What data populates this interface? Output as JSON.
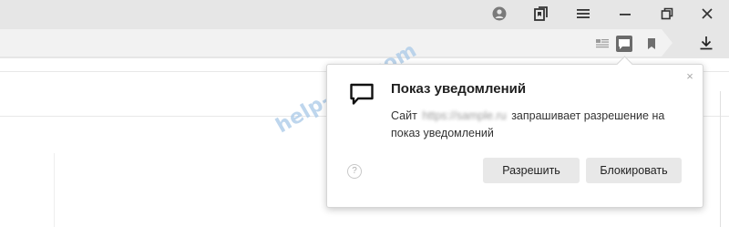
{
  "titlebar": {
    "icons": [
      "profile-icon",
      "bookmarks-manager-icon",
      "menu-icon",
      "minimize-icon",
      "restore-icon",
      "close-icon"
    ]
  },
  "addressbar": {
    "icons": [
      "reader-mode-icon",
      "notification-icon",
      "bookmark-icon",
      "download-icon"
    ]
  },
  "watermark": {
    "text": "help-wifi.com"
  },
  "popup": {
    "title": "Показ уведомлений",
    "body_prefix": "Сайт",
    "domain_blurred": "https://sample.ru",
    "body_suffix": "запрашивает разрешение на показ уведомлений",
    "help_glyph": "?",
    "close_glyph": "×",
    "allow_label": "Разрешить",
    "block_label": "Блокировать"
  },
  "colors": {
    "chrome_bg": "#e6e6e6",
    "omnibox_bg": "#f2f2f2",
    "button_bg": "#e8e8e8",
    "watermark": "#a9c9e8"
  }
}
